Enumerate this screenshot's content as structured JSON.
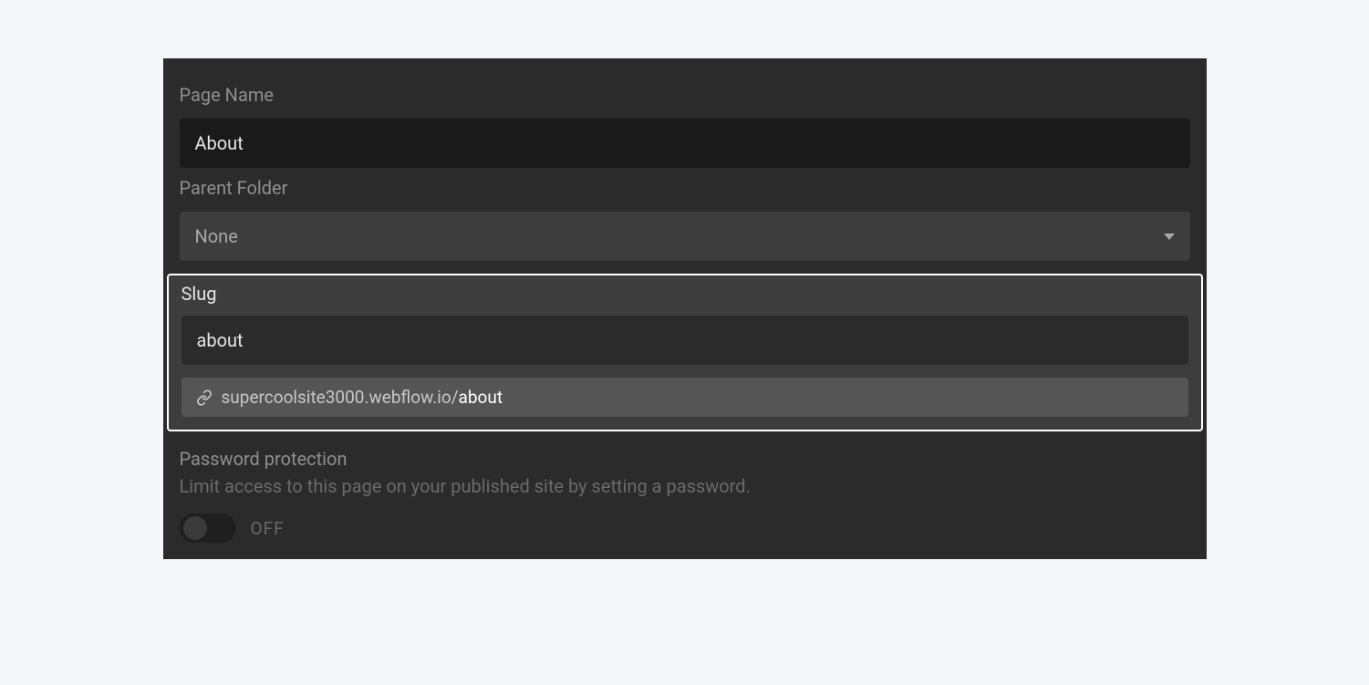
{
  "page_name": {
    "label": "Page Name",
    "value": "About"
  },
  "parent_folder": {
    "label": "Parent Folder",
    "selected": "None"
  },
  "slug": {
    "label": "Slug",
    "value": "about",
    "url_base": "supercoolsite3000.webflow.io/",
    "url_slug": "about"
  },
  "password": {
    "title": "Password protection",
    "description": "Limit access to this page on your published site by setting a password.",
    "state_label": "OFF"
  }
}
